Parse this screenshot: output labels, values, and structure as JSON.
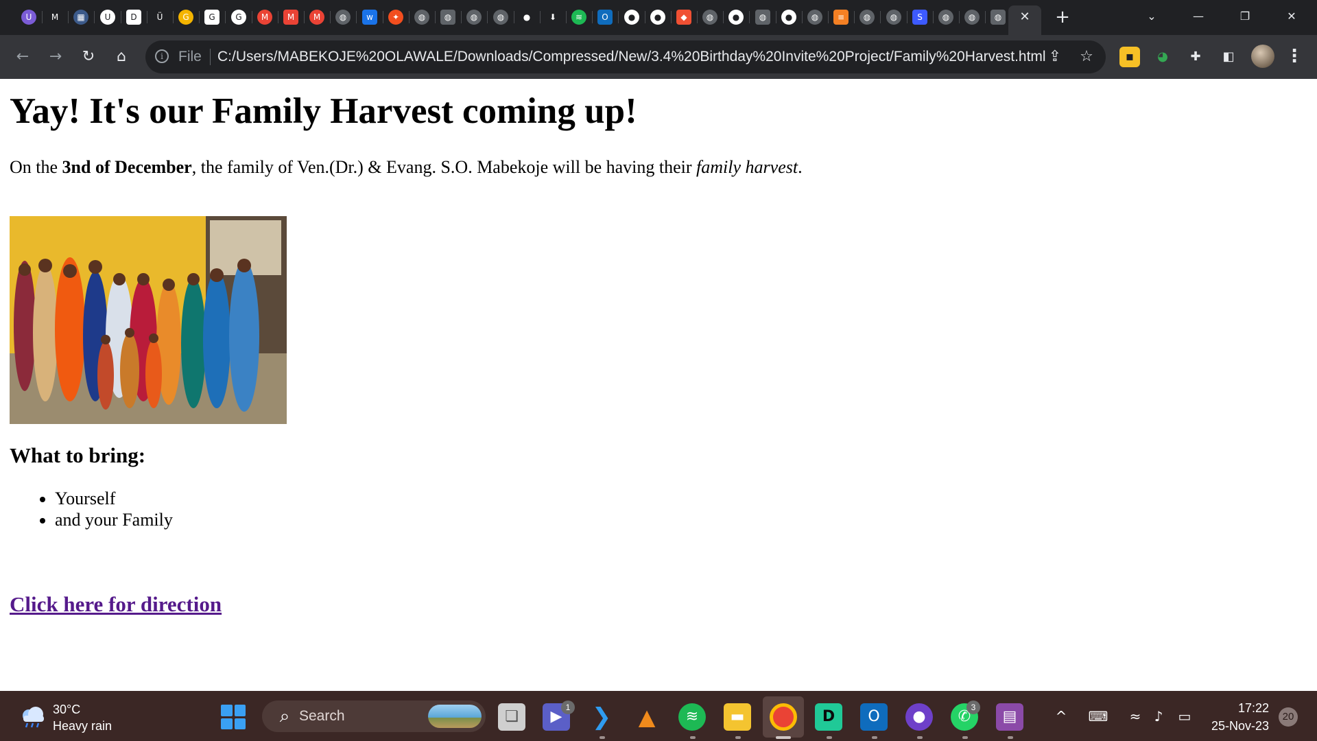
{
  "browser": {
    "tabs": [
      {
        "icon": "shield-u-icon",
        "glyph": "U",
        "color": "#7b5cd6"
      },
      {
        "icon": "medium-icon",
        "glyph": "M",
        "color": "#202124"
      },
      {
        "icon": "page-icon",
        "glyph": "▦",
        "color": "#3c5a8a"
      },
      {
        "icon": "udemy-icon",
        "glyph": "U",
        "color": "#ffffff"
      },
      {
        "icon": "dev-d-icon",
        "glyph": "D",
        "color": "#ffffff"
      },
      {
        "icon": "udemy-dark-icon",
        "glyph": "Ü",
        "color": "#202124"
      },
      {
        "icon": "google-icon",
        "glyph": "G",
        "color": "#f4b400"
      },
      {
        "icon": "google-icon",
        "glyph": "G",
        "color": "#ffffff"
      },
      {
        "icon": "google-icon",
        "glyph": "G",
        "color": "#ffffff"
      },
      {
        "icon": "gmail-icon",
        "glyph": "M",
        "color": "#ea4335"
      },
      {
        "icon": "gmail-icon",
        "glyph": "M",
        "color": "#ea4335"
      },
      {
        "icon": "gmail-icon",
        "glyph": "M",
        "color": "#ea4335"
      },
      {
        "icon": "globe-icon",
        "glyph": "◍",
        "color": "#5f6368"
      },
      {
        "icon": "w-icon",
        "glyph": "w",
        "color": "#1a73e8"
      },
      {
        "icon": "figma-icon",
        "glyph": "✦",
        "color": "#f24e1e"
      },
      {
        "icon": "globe-icon",
        "glyph": "◍",
        "color": "#5f6368"
      },
      {
        "icon": "globe-icon",
        "glyph": "◍",
        "color": "#5f6368"
      },
      {
        "icon": "globe-icon",
        "glyph": "◍",
        "color": "#5f6368"
      },
      {
        "icon": "globe-icon",
        "glyph": "◍",
        "color": "#5f6368"
      },
      {
        "icon": "github-icon",
        "glyph": "●",
        "color": "#202124"
      },
      {
        "icon": "download-icon",
        "glyph": "⬇",
        "color": "#202124"
      },
      {
        "icon": "spotify-icon",
        "glyph": "≋",
        "color": "#1db954"
      },
      {
        "icon": "outlook-icon",
        "glyph": "O",
        "color": "#0f6cbd"
      },
      {
        "icon": "github-icon",
        "glyph": "●",
        "color": "#ffffff"
      },
      {
        "icon": "github-icon",
        "glyph": "●",
        "color": "#ffffff"
      },
      {
        "icon": "git-icon",
        "glyph": "◆",
        "color": "#f05033"
      },
      {
        "icon": "globe-icon",
        "glyph": "◍",
        "color": "#5f6368"
      },
      {
        "icon": "github-icon",
        "glyph": "●",
        "color": "#ffffff"
      },
      {
        "icon": "globe-icon",
        "glyph": "◍",
        "color": "#5f6368"
      },
      {
        "icon": "github-icon",
        "glyph": "●",
        "color": "#ffffff"
      },
      {
        "icon": "globe-icon",
        "glyph": "◍",
        "color": "#5f6368"
      },
      {
        "icon": "stackoverflow-icon",
        "glyph": "≡",
        "color": "#f48024"
      },
      {
        "icon": "globe-icon",
        "glyph": "◍",
        "color": "#5f6368"
      },
      {
        "icon": "globe-icon",
        "glyph": "◍",
        "color": "#5f6368"
      },
      {
        "icon": "s-app-icon",
        "glyph": "S",
        "color": "#3d5afe"
      },
      {
        "icon": "globe-icon",
        "glyph": "◍",
        "color": "#5f6368"
      },
      {
        "icon": "globe-icon",
        "glyph": "◍",
        "color": "#5f6368"
      },
      {
        "icon": "globe-icon",
        "glyph": "◍",
        "color": "#5f6368"
      }
    ],
    "scheme_label": "File",
    "url": "C:/Users/MABEKOJE%20OLAWALE/Downloads/Compressed/New/3.4%20Birthday%20Invite%20Project/Family%20Harvest.html"
  },
  "page": {
    "heading": "Yay! It's our Family Harvest coming up!",
    "intro": {
      "before_date": "On the ",
      "date": "3nd of December",
      "middle": ", the family of Ven.(Dr.) & Evang. S.O. Mabekoje will be having their ",
      "emphasis": "family harvest",
      "after": "."
    },
    "what_to_bring_heading": "What to bring:",
    "bring_items": [
      "Yourself",
      "and your Family"
    ],
    "direction_link": "Click here for direction",
    "link_color": "#551a8b"
  },
  "taskbar": {
    "weather": {
      "temperature": "30°C",
      "condition": "Heavy rain"
    },
    "search_placeholder": "Search",
    "teams_badge": "1",
    "whatsapp_badge": "3",
    "clock": {
      "time": "17:22",
      "date": "25-Nov-23"
    },
    "notification_count": "20"
  }
}
